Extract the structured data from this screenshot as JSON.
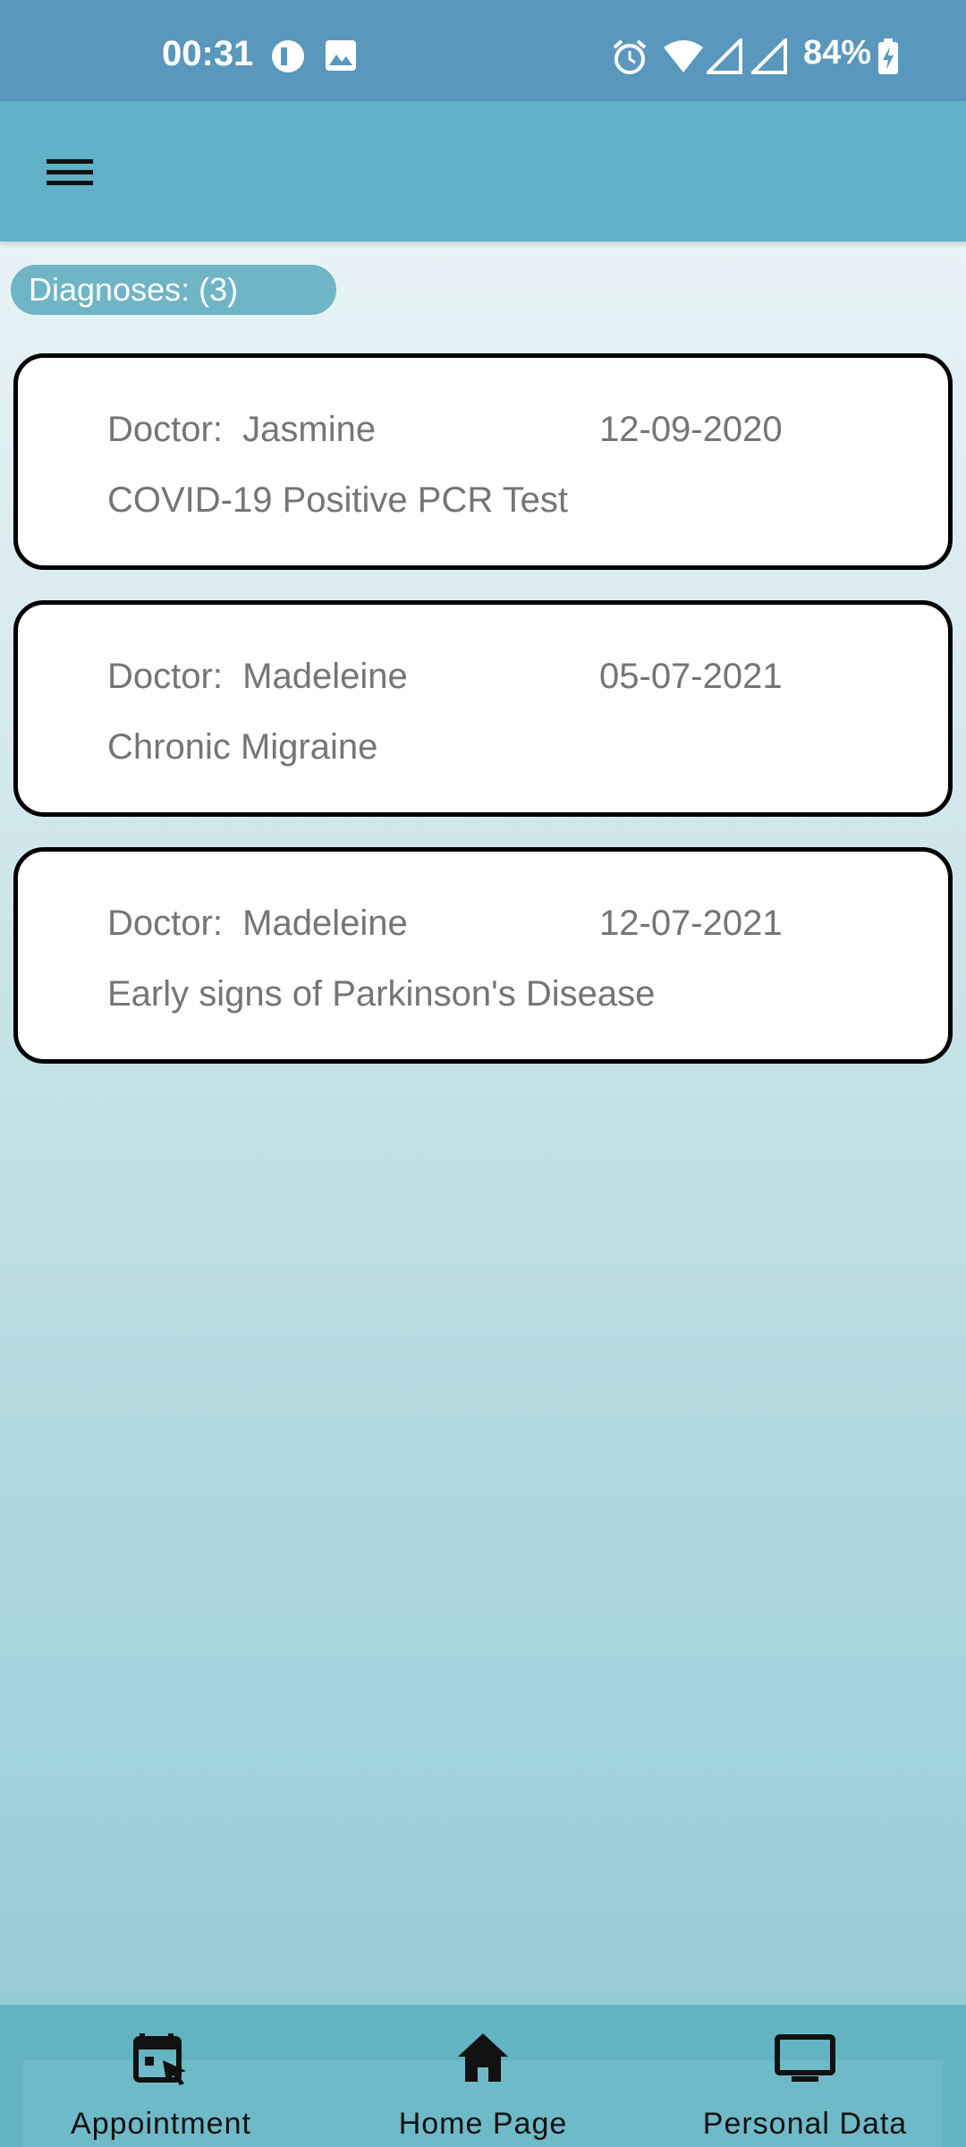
{
  "status_bar": {
    "time": "00:31",
    "battery": "84%",
    "icons": [
      "data-saver-icon",
      "image-icon",
      "alarm-icon",
      "wifi-icon",
      "signal-icon",
      "signal-icon",
      "battery-charging-icon"
    ]
  },
  "app_bar": {
    "menu_icon": "hamburger-menu-icon"
  },
  "diagnoses": {
    "count_label": "Diagnoses: (3)",
    "items": [
      {
        "doctor": "Doctor:  Jasmine",
        "date": "12-09-2020",
        "diagnosis": "COVID-19 Positive PCR Test"
      },
      {
        "doctor": "Doctor:  Madeleine",
        "date": "05-07-2021",
        "diagnosis": "Chronic Migraine"
      },
      {
        "doctor": "Doctor:  Madeleine",
        "date": "12-07-2021",
        "diagnosis": "Early signs of Parkinson's Disease"
      }
    ]
  },
  "bottom_nav": {
    "items": [
      {
        "label": "Appointment",
        "icon": "calendar-cursor-icon"
      },
      {
        "label": "Home Page",
        "icon": "home-icon"
      },
      {
        "label": "Personal Data",
        "icon": "monitor-icon"
      }
    ]
  },
  "colors": {
    "status_bar": "#5997bd",
    "app_bar": "#60b1c7",
    "pill": "#6fb5c6",
    "bottom_nav": "#64b3c2"
  }
}
